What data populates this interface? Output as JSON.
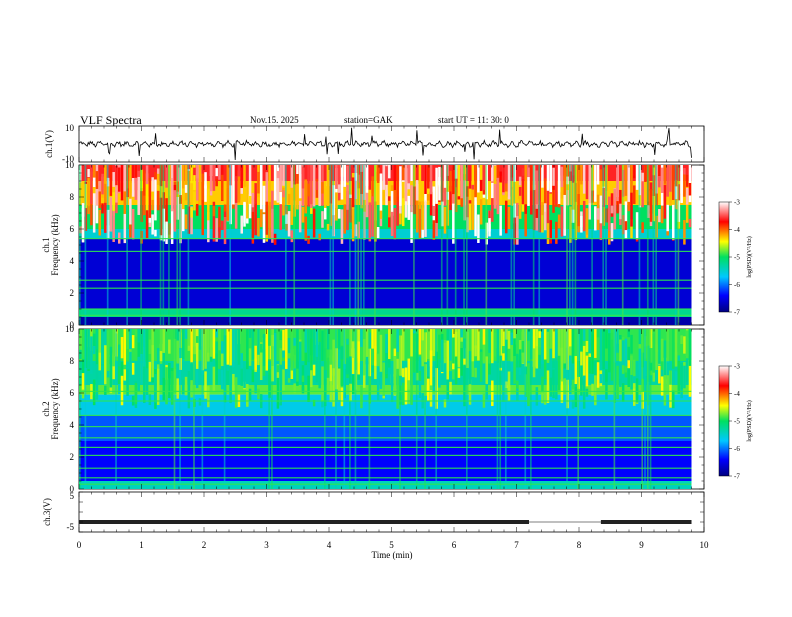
{
  "header": {
    "title": "VLF  Spectra",
    "date": "Nov.15. 2025",
    "station": "station=GAK",
    "start": "start  UT =   11: 30: 0"
  },
  "chart_data": [
    {
      "type": "line",
      "name": "ch1-waveform",
      "ylabel": "ch.1(V)",
      "ylim": [
        -10,
        10
      ],
      "ytick_labels": [
        "10",
        "-10"
      ],
      "xlim": [
        0,
        10
      ],
      "baseline": 0
    },
    {
      "type": "heatmap",
      "name": "ch1-spectrogram",
      "ylabel_line1": "ch.1",
      "ylabel_line2": "Frequency  (kHz)",
      "ylim": [
        0,
        10
      ],
      "yticks": [
        "0",
        "2",
        "4",
        "6",
        "8",
        "10"
      ],
      "xlim": [
        0,
        9.8
      ],
      "colorbar": {
        "label": "log(PSD)(V²/Hz)",
        "range": [
          -7,
          -3
        ],
        "ticks": [
          "-3",
          "-4",
          "-5",
          "-6",
          "-7"
        ]
      },
      "bands_log_psd": [
        {
          "f_khz": [
            9.0,
            10.0
          ],
          "value": -3.6
        },
        {
          "f_khz": [
            7.5,
            9.0
          ],
          "value": -4.3
        },
        {
          "f_khz": [
            6.0,
            7.5
          ],
          "value": -5.0
        },
        {
          "f_khz": [
            5.4,
            6.0
          ],
          "value": -5.5
        },
        {
          "f_khz": [
            1.0,
            5.4
          ],
          "value": -6.6
        },
        {
          "f_khz": [
            0.5,
            1.0
          ],
          "value": -5.2
        },
        {
          "f_khz": [
            0.0,
            0.5
          ],
          "value": -6.8
        }
      ]
    },
    {
      "type": "heatmap",
      "name": "ch2-spectrogram",
      "ylabel_line1": "ch.2",
      "ylabel_line2": "Frequency  (kHz)",
      "ylim": [
        0,
        10
      ],
      "yticks": [
        "0",
        "2",
        "4",
        "6",
        "8",
        "10"
      ],
      "xlim": [
        0,
        9.8
      ],
      "colorbar": {
        "label": "log(PSD)(V²/Hz)",
        "range": [
          -7,
          -3
        ],
        "ticks": [
          "-3",
          "-4",
          "-5",
          "-6",
          "-7"
        ]
      },
      "bands_log_psd": [
        {
          "f_khz": [
            8.0,
            10.0
          ],
          "value": -4.9
        },
        {
          "f_khz": [
            6.5,
            8.0
          ],
          "value": -5.3
        },
        {
          "f_khz": [
            5.9,
            6.5
          ],
          "value": -4.8
        },
        {
          "f_khz": [
            4.6,
            5.9
          ],
          "value": -5.6
        },
        {
          "f_khz": [
            3.0,
            4.6
          ],
          "value": -6.1
        },
        {
          "f_khz": [
            0.5,
            3.0
          ],
          "value": -6.4
        },
        {
          "f_khz": [
            0.0,
            0.5
          ],
          "value": -5.4
        }
      ]
    },
    {
      "type": "line",
      "name": "ch3-signal",
      "ylabel": "ch.3(V)",
      "ylim": [
        -5,
        5
      ],
      "yticks": [
        "5",
        "-5"
      ],
      "level_v": -2.5,
      "gap_min": [
        7.2,
        8.35
      ],
      "xlim": [
        0,
        10
      ],
      "xlabel": "Time  (min)",
      "xticks": [
        "0",
        "1",
        "2",
        "3",
        "4",
        "5",
        "6",
        "7",
        "8",
        "9",
        "10"
      ]
    }
  ]
}
